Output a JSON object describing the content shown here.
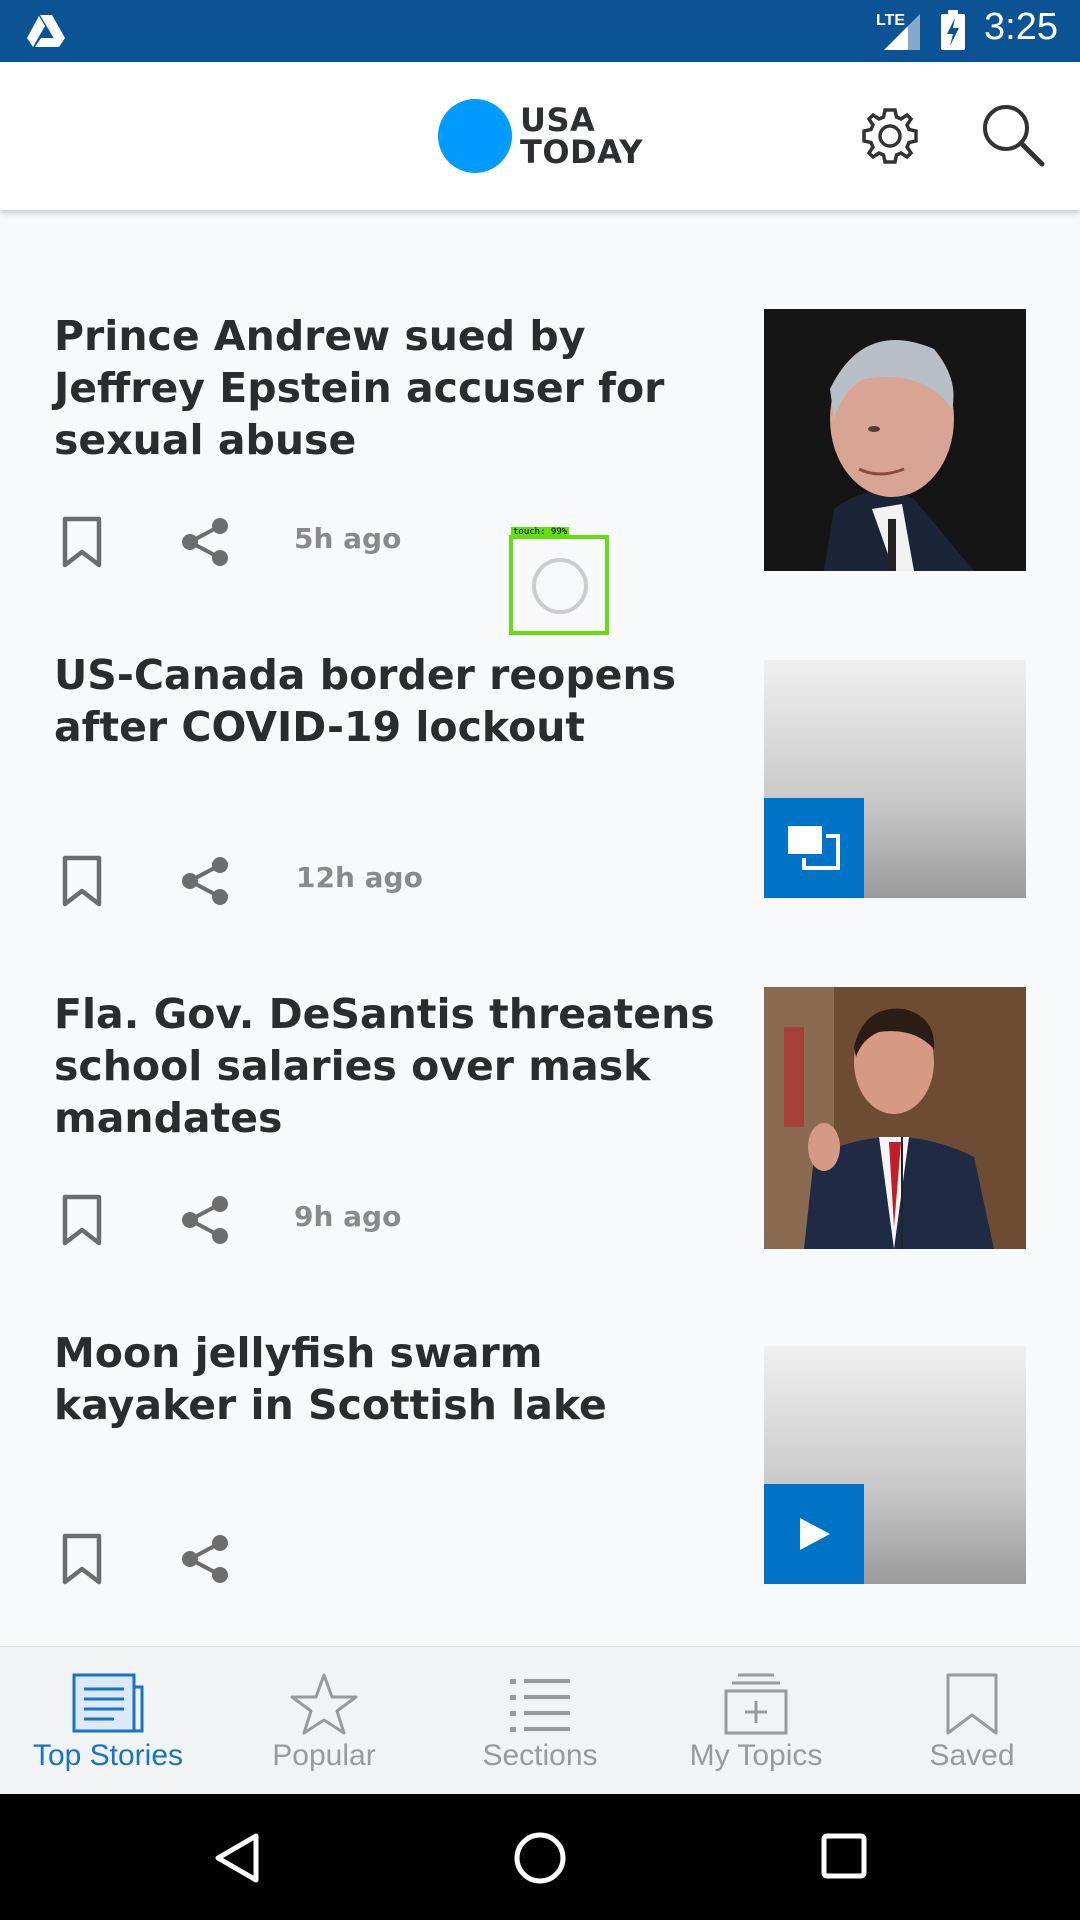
{
  "status_bar": {
    "network": "LTE",
    "time": "3:25"
  },
  "header": {
    "logo_line1": "USA",
    "logo_line2": "TODAY",
    "brand_color": "#009bff"
  },
  "articles": [
    {
      "title": "Prince Andrew sued by Jeffrey Epstein accuser for sexual abuse",
      "time": "5h ago"
    },
    {
      "title": "US-Canada border reopens after COVID-19 lockout",
      "time": "12h ago",
      "thumb_badge": "gallery-icon"
    },
    {
      "title": "Fla. Gov. DeSantis threatens school salaries over mask mandates",
      "time": "9h ago"
    },
    {
      "title": "Moon jellyfish swarm kayaker in Scottish lake",
      "time": "",
      "thumb_badge": "play-icon"
    }
  ],
  "touch_overlay": {
    "label": "touch: 99%"
  },
  "bottom_nav": {
    "items": [
      {
        "label": "Top Stories",
        "icon": "newspaper-icon",
        "active": true
      },
      {
        "label": "Popular",
        "icon": "star-icon"
      },
      {
        "label": "Sections",
        "icon": "list-icon"
      },
      {
        "label": "My Topics",
        "icon": "add-topic-icon"
      },
      {
        "label": "Saved",
        "icon": "bookmark-icon"
      }
    ],
    "active_color": "#1a73c8"
  }
}
